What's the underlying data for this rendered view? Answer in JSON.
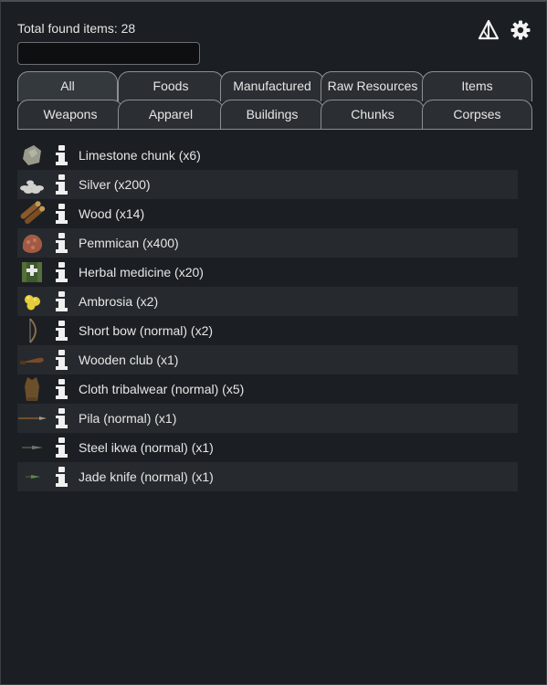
{
  "header": {
    "total_label": "Total found items: 28",
    "search": {
      "value": "",
      "placeholder": ""
    },
    "icons": [
      "triangle-marker-icon",
      "gear-icon"
    ]
  },
  "tabs": {
    "row1": [
      "All",
      "Foods",
      "Manufactured",
      "Raw Resources",
      "Items"
    ],
    "row2": [
      "Weapons",
      "Apparel",
      "Buildings",
      "Chunks",
      "Corpses"
    ],
    "active": "All"
  },
  "items": [
    {
      "label": "Limestone chunk (x6)",
      "icon": "limestone-chunk-icon"
    },
    {
      "label": "Silver (x200)",
      "icon": "silver-icon"
    },
    {
      "label": "Wood (x14)",
      "icon": "wood-icon"
    },
    {
      "label": "Pemmican (x400)",
      "icon": "pemmican-icon"
    },
    {
      "label": "Herbal medicine (x20)",
      "icon": "herbal-medicine-icon"
    },
    {
      "label": "Ambrosia (x2)",
      "icon": "ambrosia-icon"
    },
    {
      "label": "Short bow (normal) (x2)",
      "icon": "short-bow-icon"
    },
    {
      "label": "Wooden club (x1)",
      "icon": "wooden-club-icon"
    },
    {
      "label": "Cloth tribalwear (normal) (x5)",
      "icon": "tribalwear-icon"
    },
    {
      "label": "Pila (normal) (x1)",
      "icon": "pila-icon"
    },
    {
      "label": "Steel ikwa (normal) (x1)",
      "icon": "ikwa-icon"
    },
    {
      "label": "Jade knife (normal) (x1)",
      "icon": "jade-knife-icon"
    }
  ]
}
